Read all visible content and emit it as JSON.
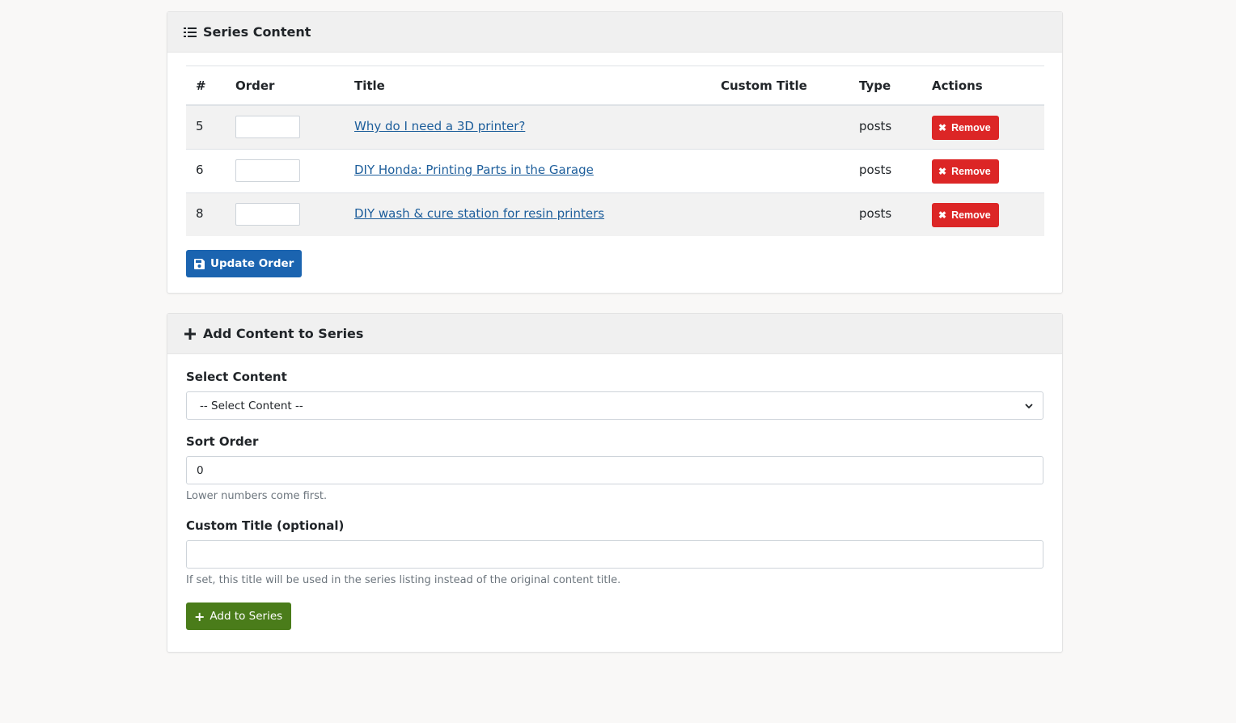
{
  "series_content": {
    "title": "Series Content",
    "columns": [
      "#",
      "Order",
      "Title",
      "Custom Title",
      "Type",
      "Actions"
    ],
    "rows": [
      {
        "num": "5",
        "order": "",
        "title": "Why do I need a 3D printer?",
        "custom_title": "",
        "type": "posts",
        "action": "Remove"
      },
      {
        "num": "6",
        "order": "",
        "title": "DIY Honda: Printing Parts in the Garage",
        "custom_title": "",
        "type": "posts",
        "action": "Remove"
      },
      {
        "num": "8",
        "order": "",
        "title": "DIY wash & cure station for resin printers",
        "custom_title": "",
        "type": "posts",
        "action": "Remove"
      }
    ],
    "update_button": "Update Order"
  },
  "add_content": {
    "title": "Add Content to Series",
    "select_label": "Select Content",
    "select_value": "-- Select Content --",
    "sort_label": "Sort Order",
    "sort_value": "0",
    "sort_help": "Lower numbers come first.",
    "custom_title_label": "Custom Title (optional)",
    "custom_title_value": "",
    "custom_title_help": "If set, this title will be used in the series listing instead of the original content title.",
    "add_button": "Add to Series"
  },
  "colors": {
    "remove": "#dc2626",
    "primary": "#1b64b0",
    "success": "#4a7c1a",
    "link": "#1d5e9b"
  }
}
